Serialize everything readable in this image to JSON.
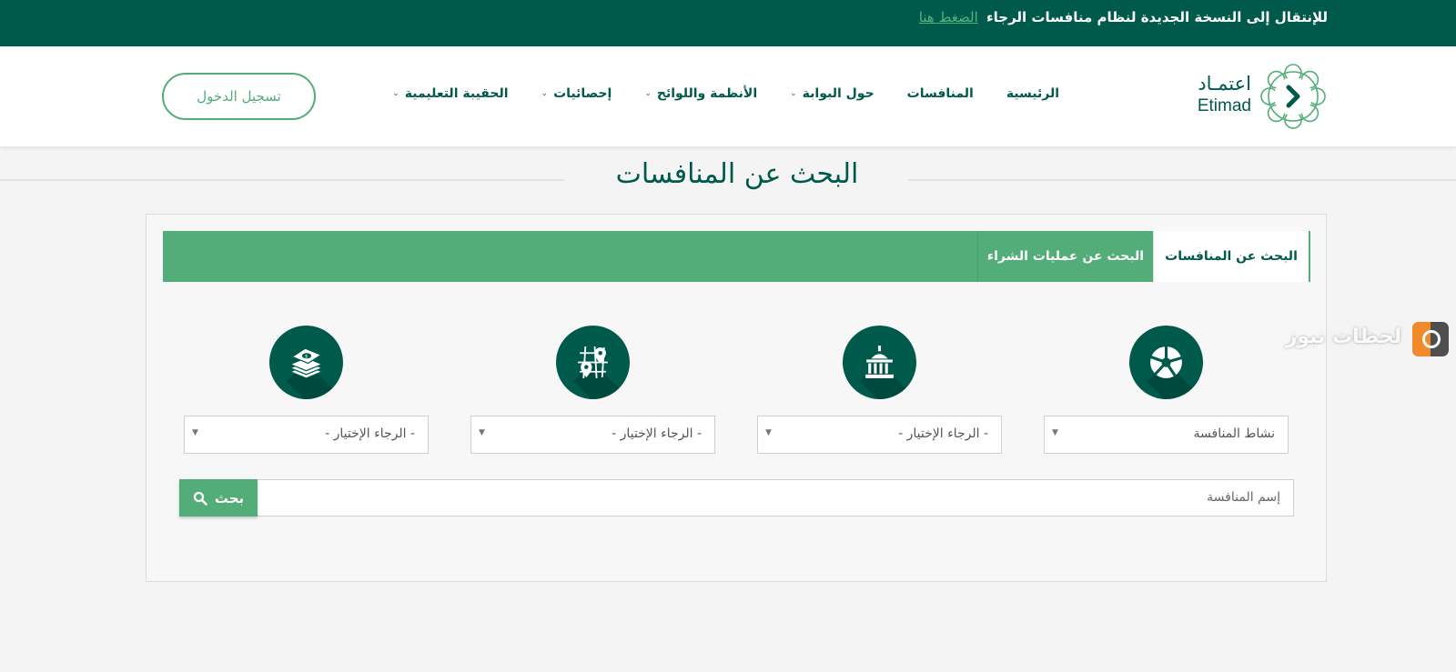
{
  "topbar": {
    "message": "للإنتقال إلى النسخة الجديدة لنظام منافسات الرجاء",
    "link_text": "الضغط هنا"
  },
  "logo": {
    "arabic": "اعتمـاد",
    "english": "Etimad"
  },
  "nav": {
    "items": [
      {
        "label": "الرئيسية",
        "has_dropdown": false
      },
      {
        "label": "المنافسات",
        "has_dropdown": false
      },
      {
        "label": "حول البوابة",
        "has_dropdown": true
      },
      {
        "label": "الأنظمة واللوائح",
        "has_dropdown": true
      },
      {
        "label": "إحصائيات",
        "has_dropdown": true
      },
      {
        "label": "الحقيبة التعليمية",
        "has_dropdown": true
      }
    ],
    "login_label": "تسجيل الدخول"
  },
  "page": {
    "title": "البحث عن المنافسات"
  },
  "tabs": [
    {
      "label": "البحث عن المنافسات",
      "active": true
    },
    {
      "label": "البحث عن عمليات الشراء",
      "active": false
    }
  ],
  "filters": [
    {
      "icon": "pie-chart-icon",
      "value": "نشاط المنافسة"
    },
    {
      "icon": "government-building-icon",
      "value": "- الرجاء الإختيار -"
    },
    {
      "icon": "map-pin-icon",
      "value": "- الرجاء الإختيار -"
    },
    {
      "icon": "money-stack-icon",
      "value": "- الرجاء الإختيار -"
    }
  ],
  "search": {
    "placeholder": "إسم المنافسة",
    "button_label": "بحث",
    "button_icon": "search-icon"
  },
  "watermark": {
    "text": "لحظات نيوز"
  },
  "colors": {
    "dark_green": "#005a4c",
    "accent_green": "#52ad78",
    "background": "#f4f4f4"
  }
}
